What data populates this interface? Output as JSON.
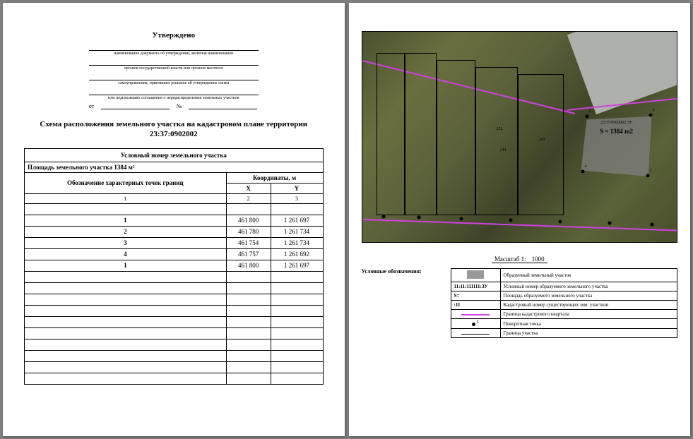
{
  "approval": {
    "header": "Утверждено",
    "cap1": "наименование документа об утверждении, включая наименование",
    "cap2": "органов государственной власти или органов местного",
    "cap3": "самоуправления, принявших решение об утверждении схемы",
    "cap4": "или подписавших соглашение о перераспределении земельных участков",
    "from": "от",
    "no": "№"
  },
  "title": "Схема расположения земельного участка на кадастровом плане территории 23:37:0902002",
  "table": {
    "thead": "Условный номер земельного участка",
    "area_row": "Площадь земельного участка 1384 м²",
    "col1": "Обозначение характерных точек границ",
    "col_group": "Координаты, м",
    "col2": "X",
    "col3": "Y",
    "sub1": "1",
    "sub2": "2",
    "sub3": "3",
    "rows": [
      {
        "n": "1",
        "x": "461 800",
        "y": "1 261 697"
      },
      {
        "n": "2",
        "x": "461 780",
        "y": "1 261 734"
      },
      {
        "n": "3",
        "x": "461 754",
        "y": "1 261 734"
      },
      {
        "n": "4",
        "x": "461 757",
        "y": "1 261 692"
      },
      {
        "n": "1",
        "x": "461 800",
        "y": "1 261 697"
      }
    ],
    "blank_rows": 10
  },
  "map": {
    "new_code": "23:37:0902002:ЗУ",
    "new_area": "S = 1384 m2",
    "parcel_labels": [
      "252",
      "243",
      "244"
    ],
    "scale_prefix": "Масштаб 1:",
    "scale": "1000"
  },
  "legend": {
    "title": "Условные обозначения:",
    "rows": [
      {
        "sym": "box",
        "txt": "Образуемый земельный участок"
      },
      {
        "sym": "txt",
        "sv": "11:11:111111:ЗУ",
        "txt": "Условный номер образуемого земельного участка"
      },
      {
        "sym": "txt",
        "sv": "S=",
        "txt": "Площадь образуемого земельного участка"
      },
      {
        "sym": "txt",
        "sv": ":11",
        "txt": "Кадастровый номер существующих зем. участков"
      },
      {
        "sym": "line-m",
        "txt": "Граница кадастрового квартала"
      },
      {
        "sym": "dot",
        "sv": "5",
        "txt": "Поворотная точка"
      },
      {
        "sym": "line-b",
        "txt": "Граница участка"
      }
    ]
  }
}
